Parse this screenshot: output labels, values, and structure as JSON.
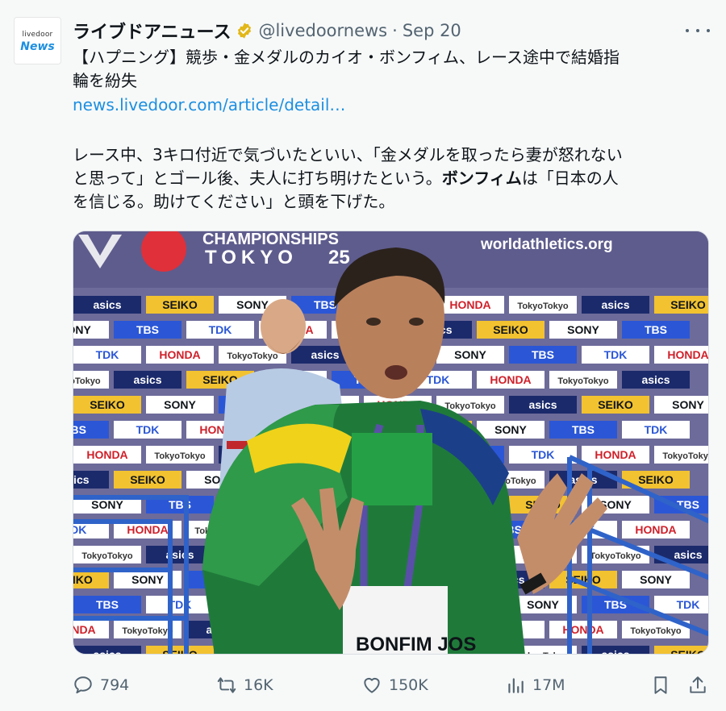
{
  "account": {
    "avatar_line1": "livedoor",
    "avatar_line2": "News",
    "name": "ライブドアニュース",
    "handle": "@livedoornews",
    "separator": "·",
    "date": "Sep 20"
  },
  "tweet": {
    "line1": "【ハプニング】競歩・金メダルのカイオ・ボンフィム、レース途中で結婚指",
    "line2": "輪を紛失",
    "link": "news.livedoor.com/article/detail…",
    "body_line1": "レース中、3キロ付近で気づいたといい、「金メダルを取ったら妻が怒れない",
    "body_line2": "と思って」とゴール後、夫人に打ち明けたという。",
    "body_bold": "ボンフィム",
    "body_line2_end": "は「日本の人",
    "body_line3": "を信じる。助けてください」と頭を下げた。"
  },
  "photo": {
    "banner_top": "CHAMPIONSHIPS",
    "banner_city": "TOKYO",
    "banner_year": "25",
    "site": "worldathletics.org",
    "sponsors": [
      "asics",
      "SEIKO",
      "SONY",
      "TBS",
      "TDK",
      "HONDA",
      "TokyoTokyo"
    ],
    "bib": "BONFIM JOS"
  },
  "actions": {
    "replies": "794",
    "reposts": "16K",
    "likes": "150K",
    "views": "17M"
  },
  "colors": {
    "accent": "#1d8fe0",
    "muted": "#536471",
    "badge": "#e2b719",
    "backdrop": "#6d6b9a"
  }
}
